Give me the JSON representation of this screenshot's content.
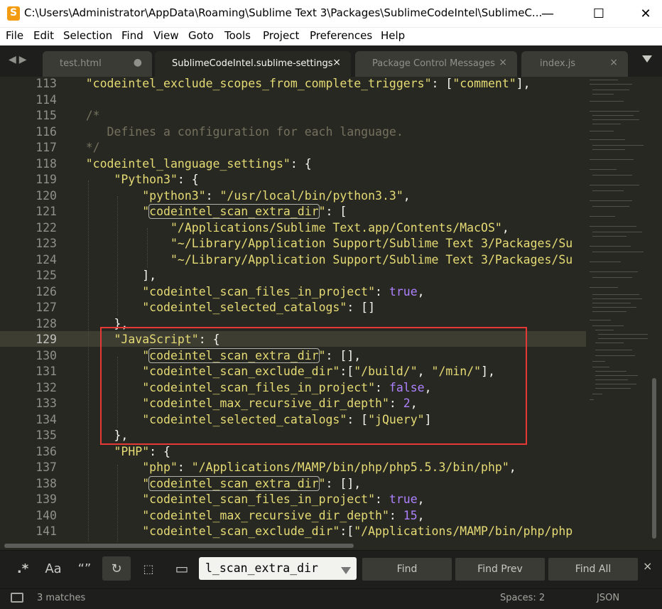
{
  "window": {
    "title": "C:\\Users\\Administrator\\AppData\\Roaming\\Sublime Text 3\\Packages\\SublimeCodeIntel\\SublimeC..."
  },
  "menu": [
    "File",
    "Edit",
    "Selection",
    "Find",
    "View",
    "Goto",
    "Tools",
    "Project",
    "Preferences",
    "Help"
  ],
  "tabs": [
    {
      "label": "test.html",
      "marker": "●",
      "active": false
    },
    {
      "label": "SublimeCodeIntel.sublime-settings",
      "marker": "×",
      "active": true
    },
    {
      "label": "Package Control Messages",
      "marker": "×",
      "active": false
    },
    {
      "label": "index.js",
      "marker": "×",
      "active": false
    }
  ],
  "editor": {
    "current_line": "129",
    "lines": [
      {
        "n": "113"
      },
      {
        "n": "114"
      },
      {
        "n": "115"
      },
      {
        "n": "116"
      },
      {
        "n": "117"
      },
      {
        "n": "118"
      },
      {
        "n": "119"
      },
      {
        "n": "120"
      },
      {
        "n": "121"
      },
      {
        "n": "122"
      },
      {
        "n": "123"
      },
      {
        "n": "124"
      },
      {
        "n": "125"
      },
      {
        "n": "126"
      },
      {
        "n": "127"
      },
      {
        "n": "128"
      },
      {
        "n": "129"
      },
      {
        "n": "130"
      },
      {
        "n": "131"
      },
      {
        "n": "132"
      },
      {
        "n": "133"
      },
      {
        "n": "134"
      },
      {
        "n": "135"
      },
      {
        "n": "136"
      },
      {
        "n": "137"
      },
      {
        "n": "138"
      },
      {
        "n": "139"
      },
      {
        "n": "140"
      },
      {
        "n": "141"
      }
    ],
    "code": {
      "l113_key": "\"codeintel_exclude_scopes_from_complete_triggers\"",
      "l113_val": "\"comment\"",
      "l115": "/*",
      "l116": "Defines a configuration for each language.",
      "l117": "*/",
      "l118_key": "\"codeintel_language_settings\"",
      "l119_key": "\"Python3\"",
      "l120_key": "\"python3\"",
      "l120_val": "\"/usr/local/bin/python3.3\"",
      "scan_extra_dir": "codeintel_scan_extra_dir",
      "l122": "\"/Applications/Sublime Text.app/Contents/MacOS\"",
      "l123": "\"~/Library/Application Support/Sublime Text 3/Packages/Su",
      "l124": "\"~/Library/Application Support/Sublime Text 3/Packages/Su",
      "scan_files_key": "\"codeintel_scan_files_in_project\"",
      "selected_catalogs_key": "\"codeintel_selected_catalogs\"",
      "l129_key": "\"JavaScript\"",
      "exclude_dir_key": "\"codeintel_scan_exclude_dir\"",
      "l131_val1": "\"/build/\"",
      "l131_val2": "\"/min/\"",
      "recursive_key": "\"codeintel_max_recursive_dir_depth\"",
      "l133_val": "2",
      "l134_val": "\"jQuery\"",
      "l136_key": "\"PHP\"",
      "l137_key": "\"php\"",
      "l137_val": "\"/Applications/MAMP/bin/php/php5.5.3/bin/php\"",
      "l140_val": "15",
      "l141_val": "\"/Applications/MAMP/bin/php/php",
      "true": "true",
      "false": "false"
    }
  },
  "find": {
    "regex": ".*",
    "case": "Aa",
    "whole_word": "“”",
    "wrap": "↻",
    "in_selection": "⬚",
    "highlight": "▭",
    "query": "l_scan_extra_dir",
    "find_label": "Find",
    "find_prev_label": "Find Prev",
    "find_all_label": "Find All",
    "close": "×"
  },
  "status": {
    "matches": "3 matches",
    "spaces": "Spaces: 2",
    "syntax": "JSON"
  }
}
